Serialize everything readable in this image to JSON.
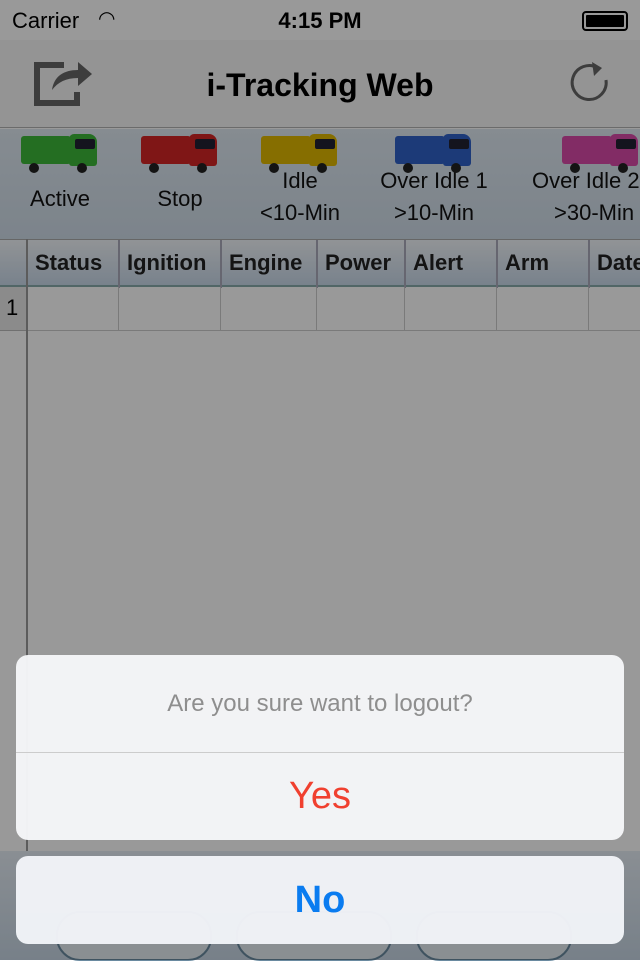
{
  "status_bar": {
    "carrier": "Carrier",
    "time": "4:15 PM",
    "wifi_icon": "wifi-icon",
    "battery_level": 100
  },
  "nav": {
    "title": "i-Tracking Web",
    "left_icon": "share-logout-icon",
    "right_icon": "refresh-icon"
  },
  "legend": [
    {
      "line1": "",
      "line2": "Active",
      "color": "#3db83a"
    },
    {
      "line1": "",
      "line2": "Stop",
      "color": "#d42626"
    },
    {
      "line1": "Idle",
      "line2": "<10-Min",
      "color": "#e0b800"
    },
    {
      "line1": "Over Idle 1",
      "line2": ">10-Min",
      "color": "#2f62c8"
    },
    {
      "line1": "Over Idle 2",
      "line2": ">30-Min",
      "color": "#d94aa8"
    }
  ],
  "grid": {
    "columns": [
      "Status",
      "Ignition",
      "Engine",
      "Power",
      "Alert",
      "Arm",
      "Date"
    ],
    "rows": [
      {
        "num": "1"
      }
    ]
  },
  "dialog": {
    "message": "Are you sure want to logout?",
    "yes_label": "Yes",
    "no_label": "No",
    "yes_color": "#f0402f",
    "no_color": "#0a7cf0"
  }
}
